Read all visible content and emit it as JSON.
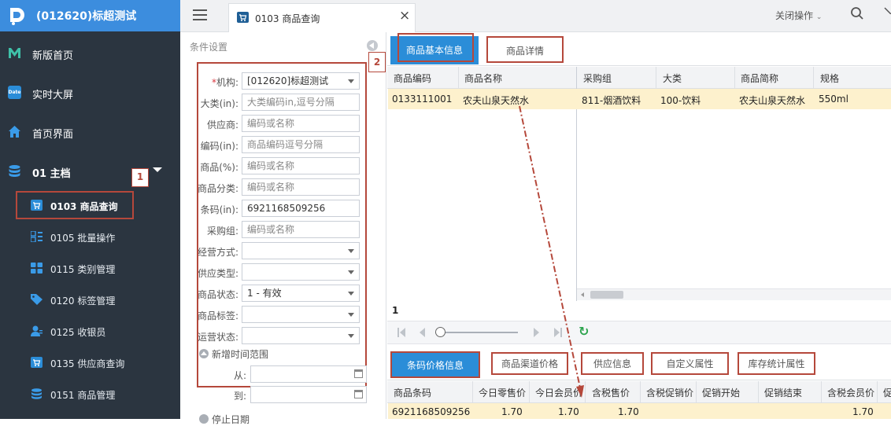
{
  "app": {
    "title": "(012620)标超测试"
  },
  "sidebar": {
    "items": [
      {
        "label": "新版首页",
        "icon": "m-logo-icon"
      },
      {
        "label": "实时大屏",
        "icon": "date-icon"
      },
      {
        "label": "首页界面",
        "icon": "home-icon"
      },
      {
        "label": "01 主档",
        "icon": "database-icon"
      }
    ],
    "subitems": [
      {
        "label": "0103 商品查询",
        "icon": "cart-icon"
      },
      {
        "label": "0105 批量操作",
        "icon": "batch-icon"
      },
      {
        "label": "0115 类别管理",
        "icon": "grid-icon"
      },
      {
        "label": "0120 标签管理",
        "icon": "tag-icon"
      },
      {
        "label": "0125 收银员",
        "icon": "user-icon"
      },
      {
        "label": "0135 供应商查询",
        "icon": "cart-icon"
      },
      {
        "label": "0151 商品管理",
        "icon": "database-icon"
      }
    ],
    "annotation1": "1"
  },
  "topbar": {
    "tab_label": "0103 商品查询",
    "close_ops": "关闭操作",
    "close_symbol": "×"
  },
  "conditions": {
    "title": "条件设置",
    "annotation2": "2",
    "fields": [
      {
        "label": "*机构:",
        "value": "[012620]标超测试",
        "type": "select"
      },
      {
        "label": "大类(in):",
        "placeholder": "大类编码in,逗号分隔",
        "type": "text"
      },
      {
        "label": "供应商:",
        "placeholder": "编码或名称",
        "type": "text"
      },
      {
        "label": "编码(in):",
        "placeholder": "商品编码逗号分隔",
        "type": "text"
      },
      {
        "label": "商品(%):",
        "placeholder": "编码或名称",
        "type": "text"
      },
      {
        "label": "商品分类:",
        "placeholder": "编码或名称",
        "type": "text"
      },
      {
        "label": "条码(in):",
        "value": "6921168509256",
        "type": "text"
      },
      {
        "label": "采购组:",
        "placeholder": "编码或名称",
        "type": "text"
      },
      {
        "label": "经营方式:",
        "value": "",
        "type": "select"
      },
      {
        "label": "供应类型:",
        "value": "",
        "type": "select"
      },
      {
        "label": "商品状态:",
        "value": "1 - 有效",
        "type": "select"
      },
      {
        "label": "商品标签:",
        "value": "",
        "type": "select"
      },
      {
        "label": "运营状态:",
        "value": "",
        "type": "select"
      }
    ],
    "new_time_range": "新增时间范围",
    "from_label": "从:",
    "to_label": "到:",
    "cut_label": "停止日期"
  },
  "main": {
    "tabs": [
      "商品基本信息",
      "商品详情"
    ],
    "grid_headers_left": [
      "商品编码",
      "商品名称"
    ],
    "grid_headers_right": [
      "采购组",
      "大类",
      "商品简称",
      "规格"
    ],
    "row": {
      "code": "0133111001",
      "name": "农夫山泉天然水",
      "group": "811-烟酒饮料",
      "category": "100-饮料",
      "short": "农夫山泉天然水",
      "spec": "550ml"
    },
    "page_num": "1",
    "refresh": "↻"
  },
  "bottom": {
    "tabs": [
      "条码价格信息",
      "商品渠道价格",
      "供应信息",
      "自定义属性",
      "库存统计属性"
    ],
    "headers": [
      "商品条码",
      "今日零售价",
      "今日会员价",
      "含税售价",
      "含税促销价",
      "促销开始",
      "促销结束",
      "含税会员价",
      "促"
    ],
    "row": {
      "barcode": "6921168509256",
      "retail": "1.70",
      "member": "1.70",
      "tax_price": "1.70",
      "tax_member": "1.70"
    }
  },
  "colors": {
    "sidebar": "#2b3540",
    "brand": "#3c8dde",
    "accent": "#2b8dd8",
    "highlight_row": "#fdf1cd",
    "annotation": "#b5483b"
  }
}
